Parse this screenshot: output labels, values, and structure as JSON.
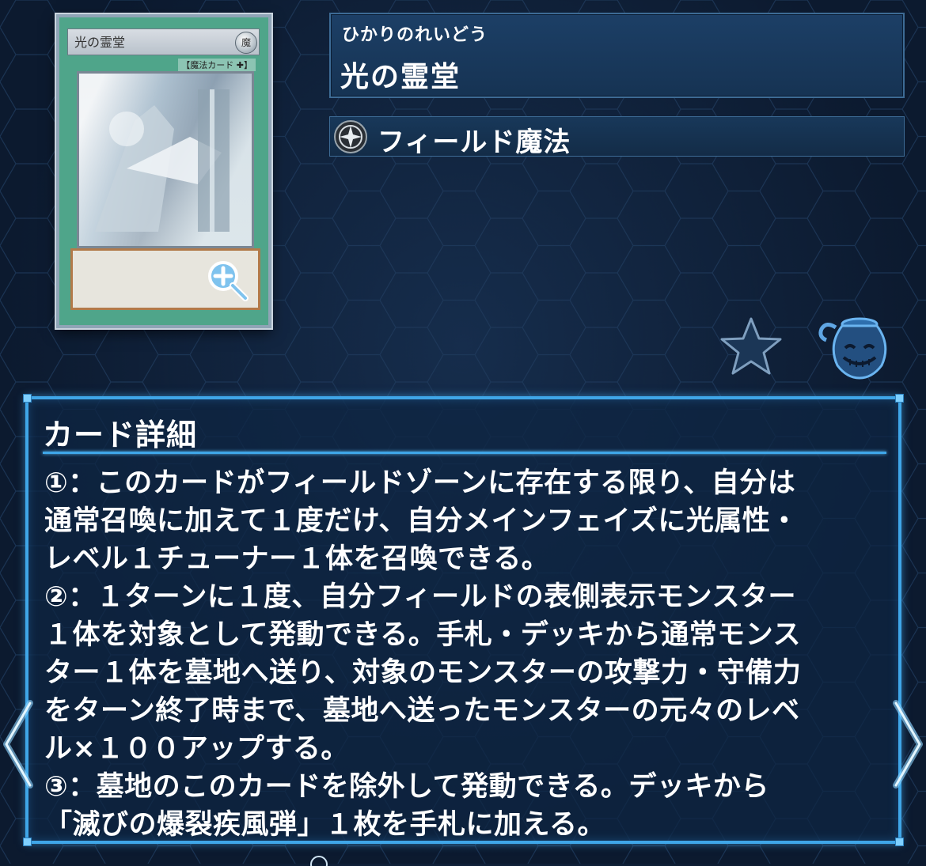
{
  "card": {
    "image_title": "光の霊堂",
    "image_attribute": "魔",
    "image_type": "【魔法カード ✚】"
  },
  "header": {
    "ruby": "ひかりのれいどう",
    "name": "光の霊堂"
  },
  "type": {
    "icon": "field-spell-icon",
    "label": "フィールド魔法"
  },
  "actions": {
    "favorite_icon": "star-icon",
    "pot_icon": "pot-of-greed-icon"
  },
  "detail": {
    "title": "カード詳細",
    "lines": [
      "①：このカードがフィールドゾーンに存在する限り、自分は",
      "通常召喚に加えて１度だけ、自分メインフェイズに光属性・",
      "レベル１チューナー１体を召喚できる。",
      "②：１ターンに１度、自分フィールドの表側表示モンスター",
      "１体を対象として発動できる。手札・デッキから通常モンス",
      "ター１体を墓地へ送り、対象のモンスターの攻撃力・守備力",
      "をターン終了時まで、墓地へ送ったモンスターの元々のレベ",
      "ル×１００アップする。",
      "③：墓地のこのカードを除外して発動できる。デッキから",
      "「滅びの爆裂疾風弾」１枚を手札に加える。"
    ]
  },
  "colors": {
    "background": "#0c1a2f",
    "panel": "#1c3f66",
    "accent": "#3fa6e8",
    "card_frame": "#4fa58a"
  }
}
